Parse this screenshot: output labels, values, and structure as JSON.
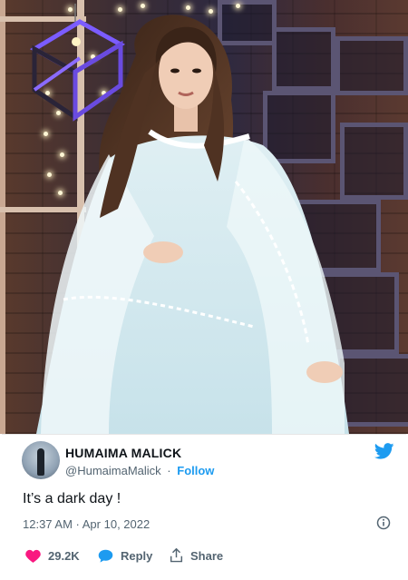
{
  "tweet": {
    "author_name": "HUMAIMA MALICK",
    "handle": "@HumaimaMalick",
    "separator": "·",
    "follow_label": "Follow",
    "text": "It’s a dark day !",
    "timestamp": "12:37 AM · Apr 10, 2022",
    "likes": "29.2K",
    "reply_label": "Reply",
    "share_label": "Share"
  },
  "colors": {
    "twitter_blue": "#1d9bf0",
    "like_red": "#f91880",
    "text_primary": "#0f1419",
    "text_secondary": "#536471"
  },
  "icons": {
    "brand": "twitter-bird-icon",
    "info": "info-icon",
    "like": "heart-icon",
    "reply": "speech-bubble-icon",
    "share": "share-icon"
  }
}
